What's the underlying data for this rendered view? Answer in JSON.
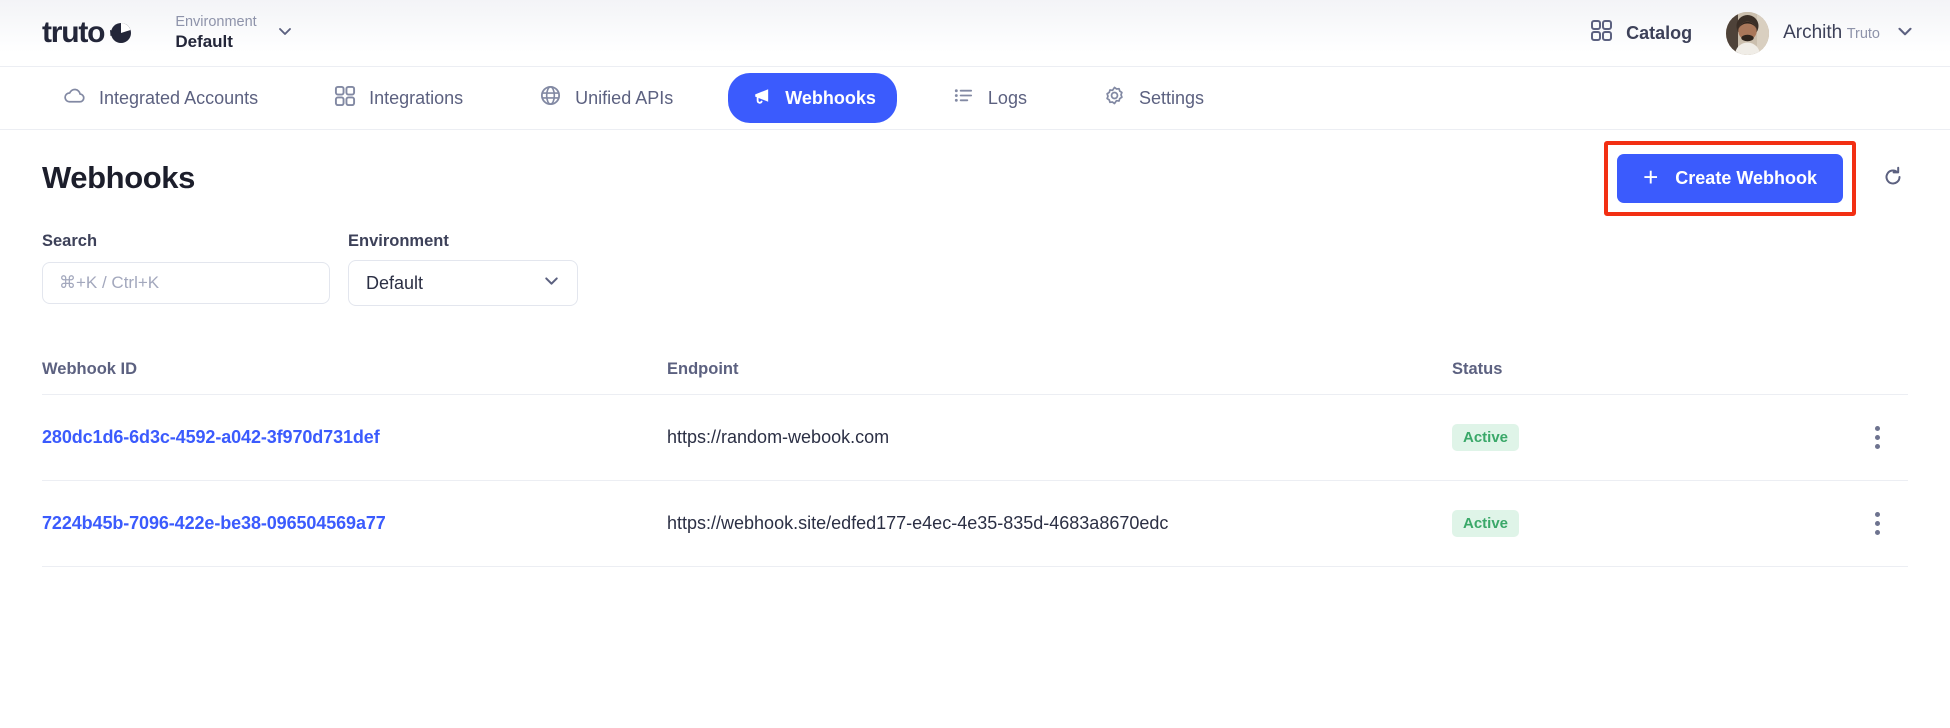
{
  "topbar": {
    "logo_text": "truto",
    "logo_icon": "truto-pie-logo-icon",
    "environment_kicker": "Environment",
    "environment_value": "Default",
    "environment_chevron_icon": "chevron-down-icon",
    "catalog_label": "Catalog",
    "catalog_icon": "grid-squares-icon",
    "user_name": "Archith",
    "user_org": "Truto",
    "user_chevron_icon": "chevron-down-icon",
    "avatar_icon": "user-avatar-photo"
  },
  "nav": {
    "items": [
      {
        "label": "Integrated Accounts",
        "icon": "cloud-icon",
        "active": false
      },
      {
        "label": "Integrations",
        "icon": "grid-squares-icon",
        "active": false
      },
      {
        "label": "Unified APIs",
        "icon": "globe-icon",
        "active": false
      },
      {
        "label": "Webhooks",
        "icon": "megaphone-icon",
        "active": true
      },
      {
        "label": "Logs",
        "icon": "list-icon",
        "active": false
      },
      {
        "label": "Settings",
        "icon": "gear-icon",
        "active": false
      }
    ]
  },
  "page": {
    "title": "Webhooks",
    "create_button_label": "Create Webhook",
    "create_button_icon": "plus-icon",
    "refresh_icon": "refresh-circular-arrow-icon",
    "highlight_color": "#f22f13",
    "accent_color": "#3b5bfd"
  },
  "filters": {
    "search_label": "Search",
    "search_placeholder": "⌘+K / Ctrl+K",
    "search_value": "",
    "environment_label": "Environment",
    "environment_selected": "Default",
    "environment_chevron_icon": "chevron-down-icon"
  },
  "table": {
    "columns": [
      "Webhook ID",
      "Endpoint",
      "Status"
    ],
    "rows": [
      {
        "webhook_id": "280dc1d6-6d3c-4592-a042-3f970d731def",
        "endpoint": "https://random-webook.com",
        "status": "Active",
        "actions_icon": "kebab-menu-icon"
      },
      {
        "webhook_id": "7224b45b-7096-422e-be38-096504569a77",
        "endpoint": "https://webhook.site/edfed177-e4ec-4e35-835d-4683a8670edc",
        "status": "Active",
        "actions_icon": "kebab-menu-icon"
      }
    ]
  }
}
